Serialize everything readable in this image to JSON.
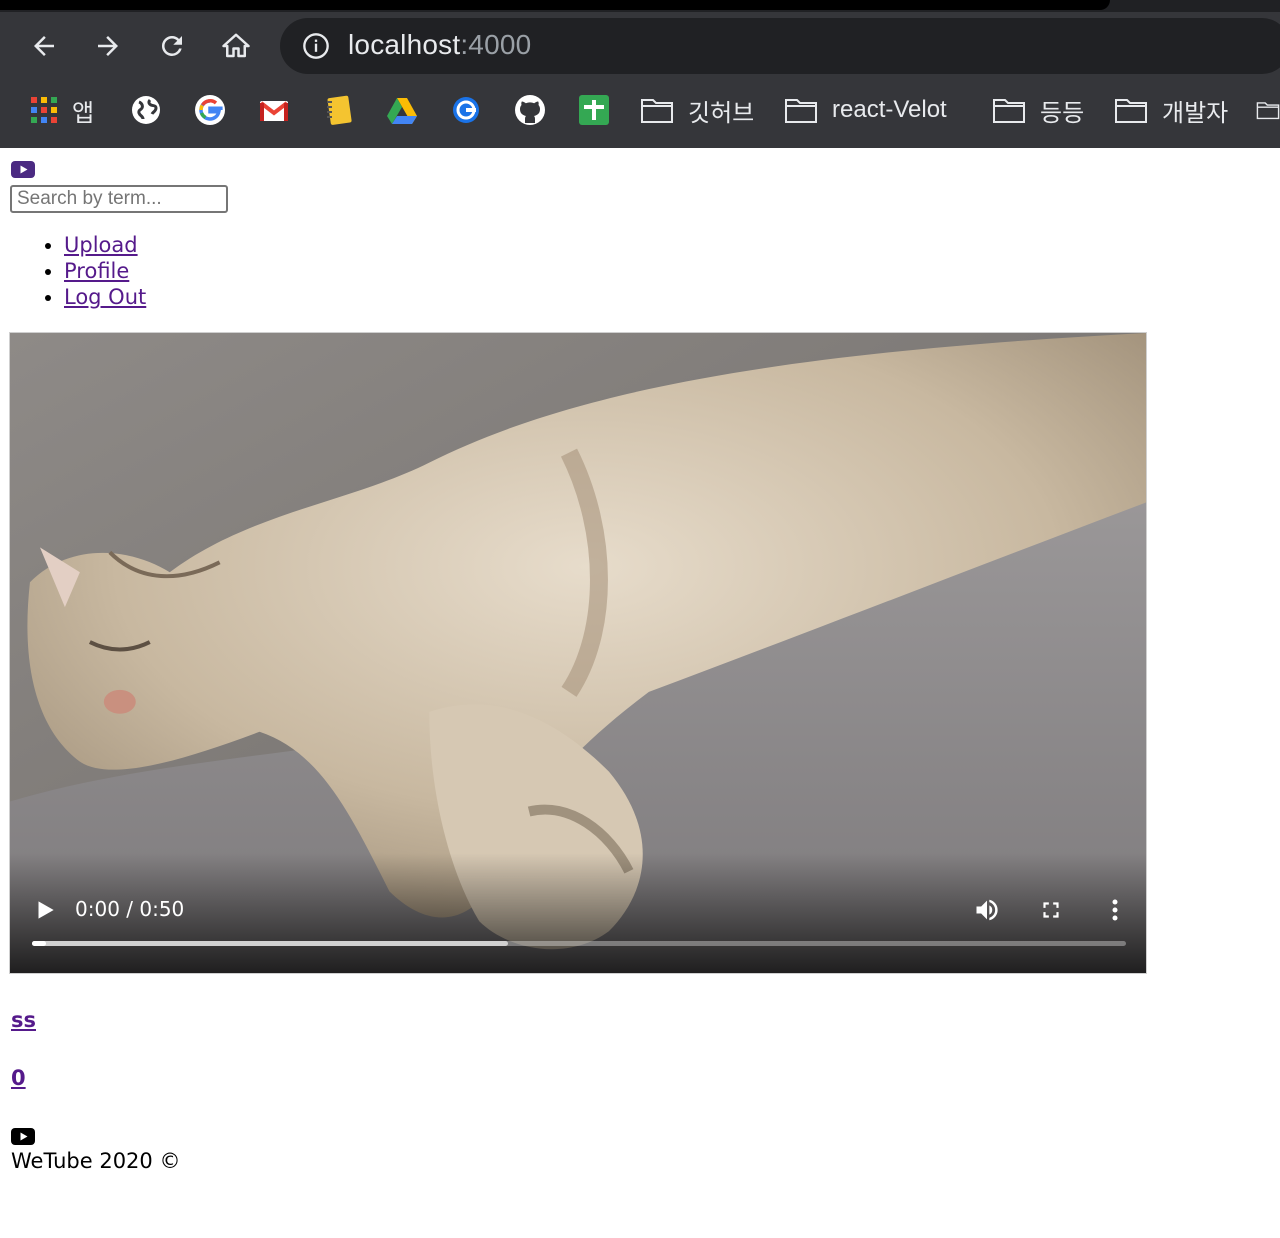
{
  "browser": {
    "url_host": "localhost",
    "url_port": ":4000",
    "nav": {
      "back_icon": "arrow-left-icon",
      "forward_icon": "arrow-right-icon",
      "reload_icon": "reload-icon",
      "home_icon": "home-icon"
    },
    "bookmarks": [
      {
        "icon": "apps-grid-icon",
        "label": "앱"
      },
      {
        "icon": "globe-icon",
        "label": ""
      },
      {
        "icon": "google-icon",
        "label": ""
      },
      {
        "icon": "gmail-icon",
        "label": ""
      },
      {
        "icon": "notebook-icon",
        "label": ""
      },
      {
        "icon": "google-drive-icon",
        "label": ""
      },
      {
        "icon": "blue-ring-icon",
        "label": ""
      },
      {
        "icon": "github-icon",
        "label": ""
      },
      {
        "icon": "google-sheets-add-icon",
        "label": ""
      },
      {
        "icon": "folder-icon",
        "label": "깃허브"
      },
      {
        "icon": "folder-icon",
        "label": "react-Velot"
      },
      {
        "icon": "folder-icon",
        "label": "등등"
      },
      {
        "icon": "folder-icon",
        "label": "개발자"
      }
    ]
  },
  "header": {
    "logo_icon": "youtube-icon",
    "search_placeholder": "Search by term...",
    "menu": [
      "Upload",
      "Profile",
      "Log Out"
    ]
  },
  "video": {
    "time_display": "0:00 / 0:50",
    "played_fraction": 0.0,
    "buffered_fraction": 0.435,
    "controls": [
      "play-icon",
      "volume-icon",
      "fullscreen-icon",
      "more-vertical-icon"
    ]
  },
  "video_info": {
    "title": "ss",
    "views": "0"
  },
  "footer": {
    "icon": "youtube-icon",
    "text": "WeTube 2020 ©"
  },
  "colors": {
    "chrome_bg": "#35363a",
    "omnibox_bg": "#202124",
    "link_visited": "#551a8b",
    "logo_purple": "#4b2a82"
  }
}
